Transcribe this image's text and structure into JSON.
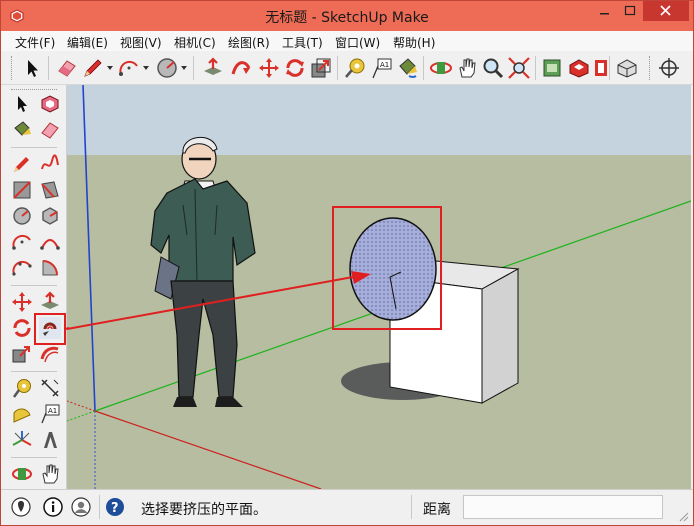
{
  "window": {
    "title": "无标题 - SketchUp Make"
  },
  "menu": [
    {
      "label": "文件(F)"
    },
    {
      "label": "编辑(E)"
    },
    {
      "label": "视图(V)"
    },
    {
      "label": "相机(C)"
    },
    {
      "label": "绘图(R)"
    },
    {
      "label": "工具(T)"
    },
    {
      "label": "窗口(W)"
    },
    {
      "label": "帮助(H)"
    }
  ],
  "toolbar_top": [
    "select-tool-icon",
    "eraser-icon",
    "pencil-icon",
    "arc-icon",
    "circle-icon",
    "push-pull-icon",
    "follow-me-icon",
    "move-icon",
    "rotate-icon",
    "scale-icon",
    "tape-measure-icon",
    "text-icon",
    "paint-bucket-icon",
    "orbit-icon",
    "pan-icon",
    "zoom-icon",
    "zoom-extents-icon",
    "3d-warehouse-icon",
    "extension-warehouse-icon",
    "layout-icon",
    "components-icon",
    "position-camera-icon"
  ],
  "toolbar_left": [
    "select-tool-icon",
    "make-component-icon",
    "paint-bucket-icon",
    "eraser-icon",
    "line-icon",
    "freehand-icon",
    "rectangle-icon",
    "rotated-rectangle-icon",
    "circle-icon",
    "polygon-icon",
    "arc-icon",
    "two-point-arc-icon",
    "three-point-arc-icon",
    "pie-icon",
    "move-icon",
    "push-pull-icon",
    "rotate-icon",
    "follow-me-icon",
    "scale-icon",
    "offset-icon",
    "tape-measure-icon",
    "dimension-icon",
    "protractor-icon",
    "text-icon",
    "axes-icon",
    "3d-text-icon",
    "orbit-icon",
    "pan-icon"
  ],
  "status": {
    "message": "选择要挤压的平面。",
    "measure_label": "距离",
    "measure_value": ""
  },
  "colors": {
    "title_bar": "#ee6b55",
    "close_button": "#c7372f",
    "sky": "#c5d3de",
    "ground": "#b6bda0",
    "callout": "#e02020",
    "selected_face": "#9fa8d6"
  }
}
